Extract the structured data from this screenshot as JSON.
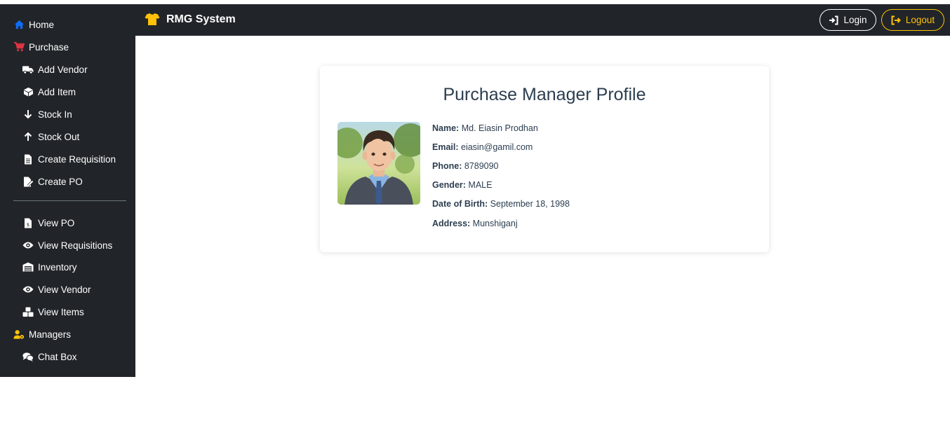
{
  "app": {
    "brand": "RMG System"
  },
  "header": {
    "login_label": "Login",
    "logout_label": "Logout"
  },
  "sidebar": {
    "home": "Home",
    "purchase": "Purchase",
    "add_vendor": "Add Vendor",
    "add_item": "Add Item",
    "stock_in": "Stock In",
    "stock_out": "Stock Out",
    "create_requisition": "Create Requisition",
    "create_po": "Create PO",
    "view_po": "View PO",
    "view_requisitions": "View Requisitions",
    "inventory": "Inventory",
    "view_vendor": "View Vendor",
    "view_items": "View Items",
    "managers": "Managers",
    "chat_box": "Chat Box"
  },
  "profile": {
    "title": "Purchase Manager Profile",
    "name_label": "Name:",
    "name": "Md. Eiasin Prodhan",
    "email_label": "Email:",
    "email": "eiasin@gamil.com",
    "phone_label": "Phone:",
    "phone": "8789090",
    "gender_label": "Gender:",
    "gender": "MALE",
    "dob_label": "Date of Birth:",
    "dob": "September 18, 1998",
    "address_label": "Address:",
    "address": "Munshiganj"
  },
  "colors": {
    "dark": "#212529",
    "home_icon": "#0d6efd",
    "purchase_icon": "#dc3545",
    "warning": "#ffc107",
    "text": "#2c3e50"
  },
  "icons": {
    "home": "house-icon",
    "purchase": "cart-icon",
    "add_vendor": "truck-icon",
    "add_item": "box-icon",
    "stock_in": "arrow-down-icon",
    "stock_out": "arrow-up-icon",
    "create_requisition": "file-icon",
    "create_po": "file-edit-icon",
    "view_po": "file-invoice-icon",
    "view_requisitions": "eye-icon",
    "inventory": "warehouse-icon",
    "view_vendor": "eye-icon",
    "view_items": "cubes-icon",
    "managers": "user-gear-icon",
    "chat_box": "comments-icon",
    "brand": "shirt-icon",
    "login": "sign-in-icon",
    "logout": "sign-out-icon"
  }
}
